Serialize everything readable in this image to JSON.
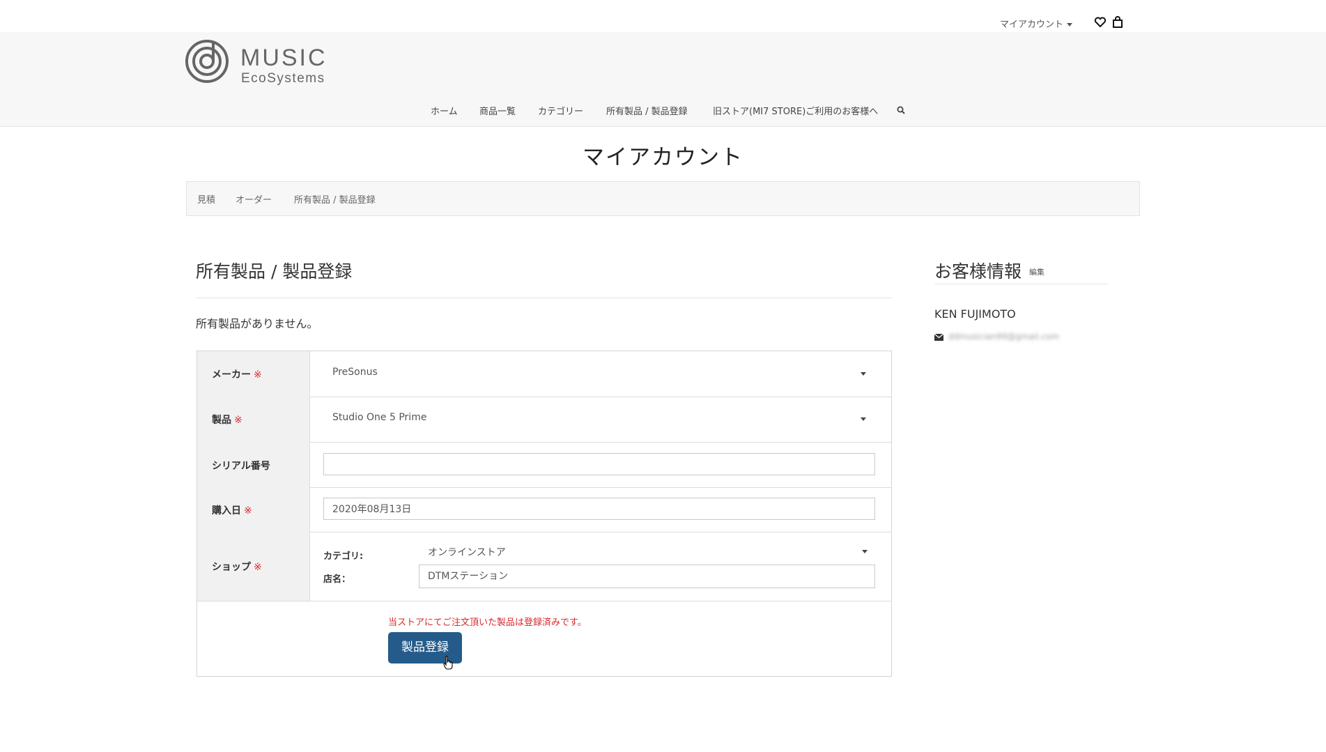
{
  "topbar": {
    "account_label": "マイアカウント"
  },
  "logo": {
    "line1": "MUSIC",
    "line2": "EcoSystems"
  },
  "nav": {
    "items": [
      "ホーム",
      "商品一覧",
      "カテゴリー",
      "所有製品 / 製品登録",
      "旧ストア(MI7 STORE)ご利用のお客様へ"
    ]
  },
  "page": {
    "title": "マイアカウント"
  },
  "tabs": [
    "見積",
    "オーダー",
    "所有製品 / 製品登録"
  ],
  "section": {
    "title": "所有製品 / 製品登録",
    "empty_text": "所有製品がありません。"
  },
  "form": {
    "maker_label": "メーカー",
    "maker_value": "PreSonus",
    "product_label": "製品",
    "product_value": "Studio One 5 Prime",
    "serial_label": "シリアル番号",
    "serial_value": "",
    "purchase_label": "購入日",
    "purchase_value": "2020年08月13日",
    "shop_label": "ショップ",
    "category_label": "カテゴリ:",
    "category_value": "オンラインストア",
    "store_label": "店名：",
    "store_value": "DTMステーション",
    "required_mark": "※",
    "notice": "当ストアにてご注文頂いた製品は登録済みです。",
    "submit_label": "製品登録"
  },
  "customer": {
    "title": "お客様情報",
    "edit_label": "編集",
    "name": "KEN FUJIMOTO",
    "email": "ddmusician99@gmail.com"
  }
}
